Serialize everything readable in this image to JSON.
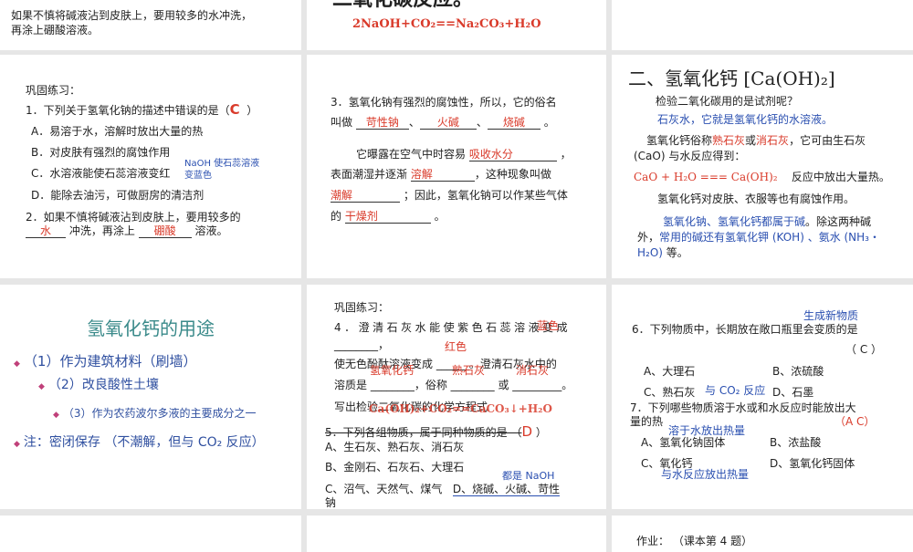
{
  "slides": {
    "s1": {
      "l1": "如果不慎将碱液沾到皮肤上，要用较多的水冲洗，",
      "l2": "再涂上硼酸溶液。"
    },
    "s2": {
      "title": "二氧化碳反应。",
      "eq": "2NaOH+CO₂==Na₂CO₃+H₂O"
    },
    "s4": {
      "head": "巩固练习：",
      "q1": "1．下列关于氢氧化钠的描述中错误的是（",
      "q1_ans": "C",
      "q1_end": "）",
      "a": "A．易溶于水，溶解时放出大量的热",
      "b": "B．对皮肤有强烈的腐蚀作用",
      "c": "C．水溶液能使石蕊溶液变红",
      "note1": "NaOH 使石蕊溶液",
      "note2": "变蓝色",
      "d": "D．能除去油污，可做厨房的清洁剂",
      "q2": "2．如果不慎将碱液沾到皮肤上，要用较多的",
      "q2_ans1": "水",
      "q2_mid": "冲洗，再涂上",
      "q2_ans2": "硼酸",
      "q2_end": "溶液。"
    },
    "s5": {
      "q3": "3．氢氧化钠有强烈的腐蚀性，所以，它的俗名",
      "called": "叫做",
      "n1": "苛性钠",
      "n2": "火碱",
      "n3": "烧碱",
      "sep": "、",
      "dot": "。",
      "l3": "它曝露在空气中时容易",
      "a1": "吸收水分",
      "comma": "，",
      "l4": "表面潮湿并逐渐",
      "a2": "溶解",
      "l4b": "，这种现象叫做",
      "a3": "潮解",
      "l5b": "；因此，氢氧化钠可以作某些气体",
      "l6": "的",
      "a4": "干燥剂"
    },
    "s6": {
      "title": "二、氢氧化钙 [Ca(OH)₂]",
      "q": "检验二氧化碳用的是试剂呢？",
      "ans": "石灰水，它就是氢氧化钙的水溶液。",
      "l1a": "氢氧化钙俗称",
      "l1b": "熟石灰",
      "l1c": "或",
      "l1d": "消石灰",
      "l1e": "，它可由生石灰",
      "l2": "(CaO) 与水反应得到：",
      "eq": "CaO + H₂O === Ca(OH)₂",
      "eq_note": "反应中放出大量热。",
      "l3": "氢氧化钙对皮肤、衣服等也有腐蚀作用。",
      "l4a": "氢氧化钠、氢氧化钙都属于碱",
      "l4b": "。除这两种碱",
      "l5a": "外，",
      "l5b": "常用的碱还有氢氧化钾 (KOH) 、氨水 (NH₃・",
      "l6a": "H₂O)",
      "l6b": " 等。"
    },
    "s7": {
      "title": "氢氧化钙的用途",
      "u1": "（1）作为建筑材料（刷墙）",
      "u2": "（2）改良酸性土壤",
      "u3": "（3）作为农药波尔多液的主要成分之一",
      "u4": "注：密闭保存  （不潮解，但与 CO₂ 反应）"
    },
    "s8": {
      "head": "巩固练习：",
      "q4": "4．澄清石灰水能使紫色石蕊溶液变成",
      "q4_over": "蓝色",
      "blank1": "________，",
      "red": "红色",
      "l2": "使无色酚酞溶液变成 ______。澄清石灰水中的",
      "o1": "氢氧化钙",
      "o2": "熟石灰",
      "o3": "消石灰",
      "l3": "溶质是 ________，俗称 ________ 或 _________。",
      "l4": "写出检验二氧化碳的化学方程式",
      "eq": "Ca(OH)₂+CO₂==CaCO₃↓+H₂O",
      "q5": "5．下列各组物质，属于同种物质的是 （",
      "q5_ans": "D",
      "q5_end": "）",
      "a": "A、生石灰、熟石灰、消石灰",
      "b": "B、金刚石、石灰石、大理石",
      "note": "都是 NaOH",
      "c": "C、沼气、天然气、煤气",
      "d": "D、烧碱、火碱、苛性",
      "d2": "钠"
    },
    "s9": {
      "note1": "生成新物质",
      "q6": "6．下列物质中，长期放在敞口瓶里会变质的是",
      "q6_ans": "（ C ）",
      "a": "A、大理石",
      "b": "B、浓硫酸",
      "c": "C、熟石灰",
      "c_note": "与 CO₂ 反应",
      "d": "D、石墨",
      "q7": "7．下列哪些物质溶于水或和水反应时能放出大",
      "q7b": "量的热",
      "q7_ans": "（A C）",
      "note2": "溶于水放出热量",
      "a7": "A、氢氧化钠固体",
      "b7": "B、浓盐酸",
      "c7": "C、氧化钙",
      "d7": "D、氢氧化钙固体",
      "note3": "与水反应放出热量"
    },
    "s12": {
      "hw": "作业：  （课本第 4 题）"
    }
  }
}
